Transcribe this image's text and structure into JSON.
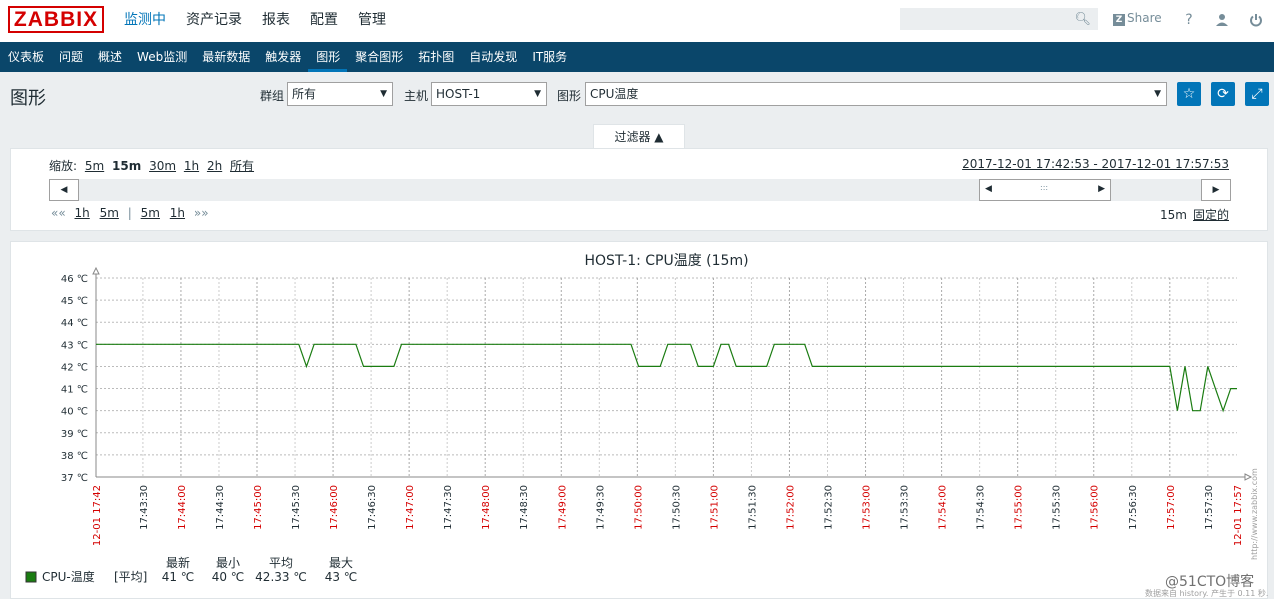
{
  "header": {
    "logo": "ZABBIX",
    "nav": [
      "监测中",
      "资产记录",
      "报表",
      "配置",
      "管理"
    ],
    "share_label": "Share",
    "icons": [
      "help-icon",
      "user-icon",
      "power-icon"
    ]
  },
  "subnav": [
    "仪表板",
    "问题",
    "概述",
    "Web监测",
    "最新数据",
    "触发器",
    "图形",
    "聚合图形",
    "拓扑图",
    "自动发现",
    "IT服务"
  ],
  "page": {
    "title": "图形",
    "group_label": "群组",
    "group_value": "所有",
    "host_label": "主机",
    "host_value": "HOST-1",
    "graph_label": "图形",
    "graph_value": "CPU温度",
    "filter_label": "过滤器 ▲"
  },
  "timebar": {
    "zoom_label": "缩放:",
    "zoom_options": [
      "5m",
      "15m",
      "30m",
      "1h",
      "2h",
      "所有"
    ],
    "current_zoom": "15m",
    "period": "2017-12-01 17:42:53 - 2017-12-01 17:57:53",
    "nav_left": "««",
    "nav_left_links": [
      "1h",
      "5m"
    ],
    "nav_sep": "|",
    "nav_right_links": [
      "5m",
      "1h"
    ],
    "nav_right": "»»",
    "duration": "15m",
    "fixed_label": "固定的"
  },
  "chart_data": {
    "type": "line",
    "title": "HOST-1: CPU温度 (15m)",
    "ylim": [
      37,
      46
    ],
    "yticks": [
      "37 ℃",
      "38 ℃",
      "39 ℃",
      "40 ℃",
      "41 ℃",
      "42 ℃",
      "43 ℃",
      "44 ℃",
      "45 ℃",
      "46 ℃"
    ],
    "x_start_label": "12-01 17:42",
    "x_end_label": "12-01 17:57",
    "xticks": [
      {
        "label": "17:43:30",
        "major": false
      },
      {
        "label": "17:44:00",
        "major": true
      },
      {
        "label": "17:44:30",
        "major": false
      },
      {
        "label": "17:45:00",
        "major": true
      },
      {
        "label": "17:45:30",
        "major": false
      },
      {
        "label": "17:46:00",
        "major": true
      },
      {
        "label": "17:46:30",
        "major": false
      },
      {
        "label": "17:47:00",
        "major": true
      },
      {
        "label": "17:47:30",
        "major": false
      },
      {
        "label": "17:48:00",
        "major": true
      },
      {
        "label": "17:48:30",
        "major": false
      },
      {
        "label": "17:49:00",
        "major": true
      },
      {
        "label": "17:49:30",
        "major": false
      },
      {
        "label": "17:50:00",
        "major": true
      },
      {
        "label": "17:50:30",
        "major": false
      },
      {
        "label": "17:51:00",
        "major": true
      },
      {
        "label": "17:51:30",
        "major": false
      },
      {
        "label": "17:52:00",
        "major": true
      },
      {
        "label": "17:52:30",
        "major": false
      },
      {
        "label": "17:53:00",
        "major": true
      },
      {
        "label": "17:53:30",
        "major": false
      },
      {
        "label": "17:54:00",
        "major": true
      },
      {
        "label": "17:54:30",
        "major": false
      },
      {
        "label": "17:55:00",
        "major": true
      },
      {
        "label": "17:55:30",
        "major": false
      },
      {
        "label": "17:56:00",
        "major": true
      },
      {
        "label": "17:56:30",
        "major": false
      },
      {
        "label": "17:57:00",
        "major": true
      },
      {
        "label": "17:57:30",
        "major": false
      }
    ],
    "series": [
      {
        "name": "CPU-温度",
        "color": "#1a7c11",
        "x": [
          "17:42:53",
          "17:45:33",
          "17:45:39",
          "17:45:45",
          "17:46:18",
          "17:46:24",
          "17:46:48",
          "17:46:54",
          "17:49:55",
          "17:50:01",
          "17:50:18",
          "17:50:24",
          "17:50:42",
          "17:50:48",
          "17:51:00",
          "17:51:06",
          "17:51:12",
          "17:51:18",
          "17:51:42",
          "17:51:48",
          "17:51:54",
          "17:52:12",
          "17:52:18",
          "17:52:30",
          "17:52:36",
          "17:57:00",
          "17:57:06",
          "17:57:12",
          "17:57:18",
          "17:57:24",
          "17:57:30",
          "17:57:36",
          "17:57:42",
          "17:57:48",
          "17:57:53"
        ],
        "values": [
          43,
          43,
          42,
          43,
          43,
          42,
          42,
          43,
          43,
          42,
          42,
          43,
          43,
          42,
          42,
          43,
          43,
          42,
          42,
          43,
          43,
          43,
          42,
          42,
          42,
          42,
          40,
          42,
          40,
          40,
          42,
          41,
          40,
          41,
          41
        ]
      }
    ],
    "legend": {
      "name": "CPU-温度",
      "func": "[平均]",
      "columns": [
        "最新",
        "最小",
        "平均",
        "最大"
      ],
      "values": [
        "41 ℃",
        "40 ℃",
        "42.33 ℃",
        "43 ℃"
      ]
    },
    "side_text": "http://www.zabbix.com"
  },
  "footer": {
    "data_note": "数据来自 history. 产生于 0.11 秒.",
    "watermark": "@51CTO博客"
  }
}
